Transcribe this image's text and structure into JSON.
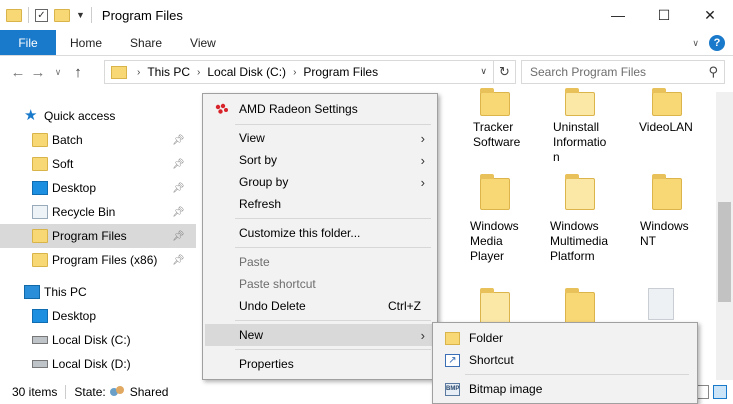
{
  "window": {
    "title": "Program Files",
    "controls": {
      "minimize": "—",
      "maximize": "☐",
      "close": "✕"
    }
  },
  "ribbon": {
    "tabs": [
      "File",
      "Home",
      "Share",
      "View"
    ],
    "help": "?"
  },
  "address": {
    "crumbs": [
      "This PC",
      "Local Disk (C:)",
      "Program Files"
    ],
    "search_placeholder": "Search Program Files"
  },
  "sidebar": {
    "quick_access": "Quick access",
    "pinned": [
      "Batch",
      "Soft",
      "Desktop",
      "Recycle Bin",
      "Program Files",
      "Program Files (x86)"
    ],
    "this_pc": "This PC",
    "pc_items": [
      "Desktop",
      "Local Disk (C:)",
      "Local Disk (D:)"
    ]
  },
  "files": {
    "row1": [
      "Tracker Software",
      "Uninstall Informatio n",
      "VideoLAN"
    ],
    "row2": [
      "Windows Media Player",
      "Windows Multimedia Platform",
      "Windows NT"
    ]
  },
  "context_menu": {
    "amd": "AMD Radeon Settings",
    "view": "View",
    "sort_by": "Sort by",
    "group_by": "Group by",
    "refresh": "Refresh",
    "customize": "Customize this folder...",
    "paste": "Paste",
    "paste_shortcut": "Paste shortcut",
    "undo_delete": "Undo Delete",
    "undo_shortcut": "Ctrl+Z",
    "new": "New",
    "properties": "Properties"
  },
  "submenu": {
    "folder": "Folder",
    "shortcut": "Shortcut",
    "bitmap": "Bitmap image"
  },
  "status": {
    "items": "30 items",
    "state_label": "State:",
    "state_value": "Shared"
  },
  "colors": {
    "accent": "#1979ca",
    "folder": "#f8d775",
    "menu_bg": "#f2f2f2",
    "selection": "#d9d9d9"
  }
}
